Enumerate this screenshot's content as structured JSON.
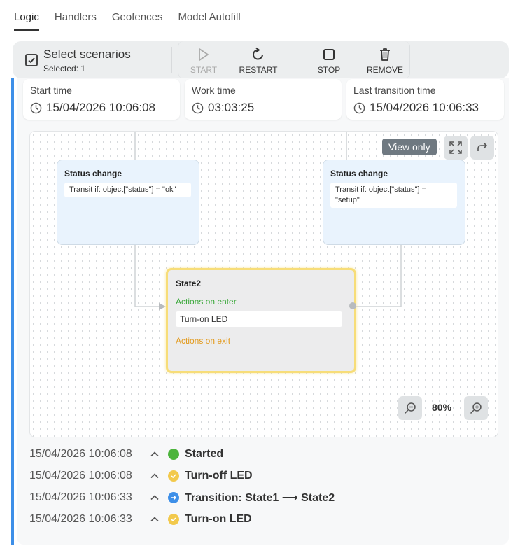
{
  "tabs": [
    {
      "label": "Logic",
      "active": true
    },
    {
      "label": "Handlers"
    },
    {
      "label": "Geofences"
    },
    {
      "label": "Model Autofill"
    }
  ],
  "toolbar": {
    "select_title": "Select scenarios",
    "selected_text": "Selected: 1",
    "start_label": "START",
    "restart_label": "RESTART",
    "stop_label": "STOP",
    "remove_label": "REMOVE"
  },
  "times": {
    "start_label": "Start time",
    "start_value": "15/04/2026 10:06:08",
    "work_label": "Work time",
    "work_value": "03:03:25",
    "last_label": "Last transition time",
    "last_value": "15/04/2026 10:06:33"
  },
  "canvas": {
    "view_only": "View only",
    "zoom": "80%",
    "left_node": {
      "title": "Status change",
      "condition": "Transit if: object[\"status\"] = \"ok\""
    },
    "right_node": {
      "title": "Status change",
      "condition": "Transit if: object[\"status\"] = \"setup\""
    },
    "state_node": {
      "title": "State2",
      "enter_label": "Actions on enter",
      "action": "Turn-on LED",
      "exit_label": "Actions on exit"
    }
  },
  "log": [
    {
      "time": "15/04/2026 10:06:08",
      "text": "Started",
      "kind": "started"
    },
    {
      "time": "15/04/2026 10:06:08",
      "text": "Turn-off LED",
      "kind": "action"
    },
    {
      "time": "15/04/2026 10:06:33",
      "text": "Transition: State1 ⟶ State2",
      "kind": "transition"
    },
    {
      "time": "15/04/2026 10:06:33",
      "text": "Turn-on LED",
      "kind": "action"
    }
  ],
  "colors": {
    "accent": "#3d8fe8",
    "started": "#4cb43c",
    "action": "#f2c94c",
    "transition": "#3d8fe8",
    "enter": "#3aa83a",
    "exit": "#e39a1c",
    "state_border": "#f7dd78"
  }
}
